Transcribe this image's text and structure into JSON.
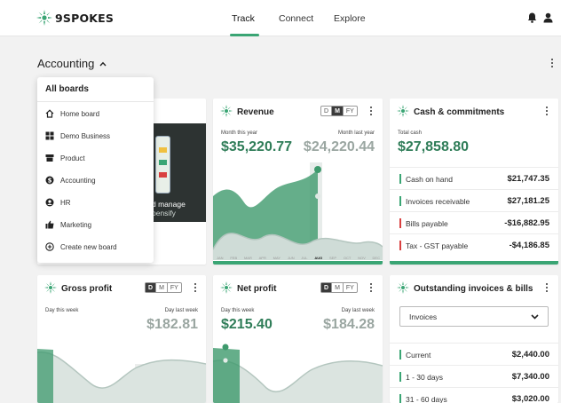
{
  "brand": {
    "name": "9SPOKES",
    "logo_color": "#3aa574"
  },
  "nav": {
    "items": [
      {
        "label": "Track"
      },
      {
        "label": "Connect"
      },
      {
        "label": "Explore"
      }
    ],
    "active": "Track"
  },
  "header_icons": [
    "bell-icon",
    "user-icon"
  ],
  "dashboard": {
    "title": "Accounting"
  },
  "dropdown": {
    "heading": "All boards",
    "items": [
      {
        "label": "Home board",
        "icon": "home-icon"
      },
      {
        "label": "Demo Business",
        "icon": "grid-icon"
      },
      {
        "label": "Product",
        "icon": "product-icon"
      },
      {
        "label": "Accounting",
        "icon": "dollar-icon"
      },
      {
        "label": "HR",
        "icon": "person-icon"
      },
      {
        "label": "Marketing",
        "icon": "thumbs-up-icon"
      },
      {
        "label": "Create new board",
        "icon": "plus-circle-icon"
      }
    ]
  },
  "promo_card": {
    "text_line1": "d manage",
    "text_line2": "pensify"
  },
  "revenue": {
    "title": "Revenue",
    "periods": [
      "D",
      "M",
      "FY"
    ],
    "active_period": "M",
    "label_current": "Month this year",
    "label_previous": "Month last year",
    "value_current": "$35,220.77",
    "value_previous": "$24,220.44",
    "months": [
      "JAN",
      "FEB",
      "MAR",
      "APR",
      "MAY",
      "JUN",
      "JUL",
      "AUG",
      "SEP",
      "OCT",
      "NOV",
      "DEC"
    ],
    "highlight_month": "AUG"
  },
  "cash": {
    "title": "Cash & commitments",
    "total_label": "Total cash",
    "total_value": "$27,858.80",
    "rows": [
      {
        "label": "Cash on hand",
        "value": "$21,747.35",
        "color": "#3aa574"
      },
      {
        "label": "Invoices receivable",
        "value": "$27,181.25",
        "color": "#3aa574"
      },
      {
        "label": "Bills payable",
        "value": "-$16,882.95",
        "color": "#d94040"
      },
      {
        "label": "Tax - GST payable",
        "value": "-$4,186.85",
        "color": "#d94040"
      }
    ]
  },
  "gross": {
    "title": "Gross profit",
    "periods": [
      "D",
      "M",
      "FY"
    ],
    "active_period": "D",
    "label_current": "Day this week",
    "label_previous": "Day last week",
    "value_previous": "$182.81"
  },
  "net": {
    "title": "Net profit",
    "periods": [
      "D",
      "M",
      "FY"
    ],
    "active_period": "D",
    "label_current": "Day this week",
    "label_previous": "Day last week",
    "value_current": "$215.40",
    "value_previous": "$184.28"
  },
  "outstanding": {
    "title": "Outstanding invoices & bills",
    "select_value": "Invoices",
    "rows": [
      {
        "label": "Current",
        "value": "$2,440.00"
      },
      {
        "label": "1 - 30 days",
        "value": "$7,340.00"
      },
      {
        "label": "31 - 60 days",
        "value": "$3,020.00"
      }
    ]
  }
}
